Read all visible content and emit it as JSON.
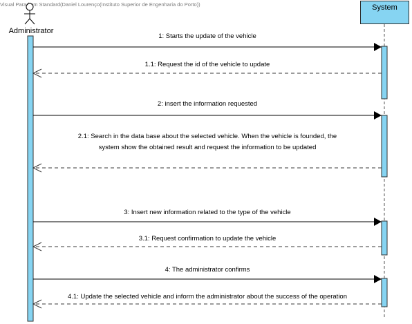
{
  "watermark": "Visual Paradigm Standard(Daniel Lourenço(Instituto Superior de Engenharia do Porto))",
  "lifelines": {
    "actor": "Administrator",
    "system": "System"
  },
  "messages": [
    {
      "text": "1: Starts the update of the vehicle",
      "type": "sync"
    },
    {
      "text": "1.1: Request the id of the vehicle to update",
      "type": "return"
    },
    {
      "text": "2: insert the information requested",
      "type": "sync"
    },
    {
      "text": "2.1: Search in the data base about the selected vehicle. When the vehicle is founded, the system show the obtained result and request the information to be updated",
      "type": "return"
    },
    {
      "text": "3: Insert new information related to the type of the vehicle",
      "type": "sync"
    },
    {
      "text": "3.1: Request confirmation to update the vehicle",
      "type": "return"
    },
    {
      "text": "4: The administrator confirms",
      "type": "sync"
    },
    {
      "text": "4.1: Update the selected vehicle and inform the administrator about the success of the operation",
      "type": "return"
    }
  ],
  "colors": {
    "activation": "#86d4f2",
    "line": "#000000",
    "dashed": "#3a3a3a"
  }
}
